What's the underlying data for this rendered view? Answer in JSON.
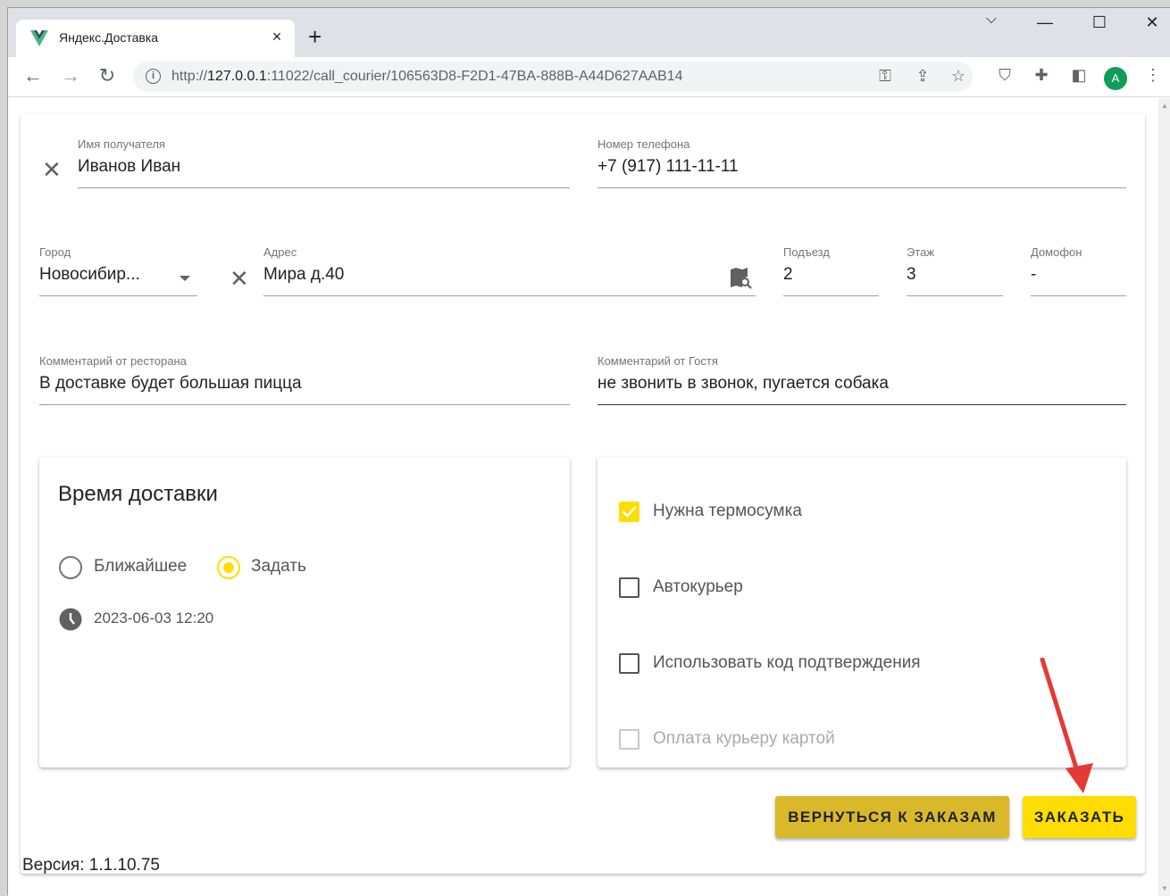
{
  "browser": {
    "tab_title": "Яндекс.Доставка",
    "tab_close": "×",
    "new_tab": "+",
    "url_prefix": "http://",
    "url_host": "127.0.0.1",
    "url_rest": ":11022/call_courier/106563D8-F2D1-47BA-888B-A44D627AAB14",
    "avatar_letter": "A",
    "icons": [
      "back-icon",
      "forward-icon",
      "reload-icon",
      "info-icon",
      "key-icon",
      "share-icon",
      "star-icon",
      "shield-extension-icon",
      "puzzle-icon",
      "side-panel-icon",
      "menu-icon"
    ]
  },
  "form": {
    "recipient": {
      "label": "Имя получателя",
      "value": "Иванов Иван"
    },
    "phone": {
      "label": "Номер телефона",
      "value": "+7 (917) 111-11-11"
    },
    "city": {
      "label": "Город",
      "value": "Новосибир..."
    },
    "address": {
      "label": "Адрес",
      "value": "Мира д.40"
    },
    "entrance": {
      "label": "Подъезд",
      "value": "2"
    },
    "floor": {
      "label": "Этаж",
      "value": "3"
    },
    "intercom": {
      "label": "Домофон",
      "value": "-"
    },
    "restaurant_comment": {
      "label": "Комментарий от ресторана",
      "value": "В доставке будет большая пицца"
    },
    "guest_comment": {
      "label": "Комментарий от Гостя",
      "value": "не звонить в звонок, пугается собака"
    }
  },
  "delivery_time": {
    "title": "Время доставки",
    "options": [
      {
        "label": "Ближайшее",
        "selected": false
      },
      {
        "label": "Задать",
        "selected": true
      }
    ],
    "datetime": "2023-06-03 12:20"
  },
  "options": [
    {
      "label": "Нужна термосумка",
      "checked": true,
      "disabled": false
    },
    {
      "label": "Автокурьер",
      "checked": false,
      "disabled": false
    },
    {
      "label": "Использовать код подтверждения",
      "checked": false,
      "disabled": false
    },
    {
      "label": "Оплата курьеру картой",
      "checked": false,
      "disabled": true
    }
  ],
  "buttons": {
    "back": "ВЕРНУТЬСЯ К ЗАКАЗАМ",
    "order": "ЗАКАЗАТЬ"
  },
  "version": "Версия: 1.1.10.75",
  "colors": {
    "accent": "#ffdd00",
    "back_button": "#d9b92a",
    "order_button": "#ffdd00",
    "annotation_arrow": "#e53935"
  }
}
